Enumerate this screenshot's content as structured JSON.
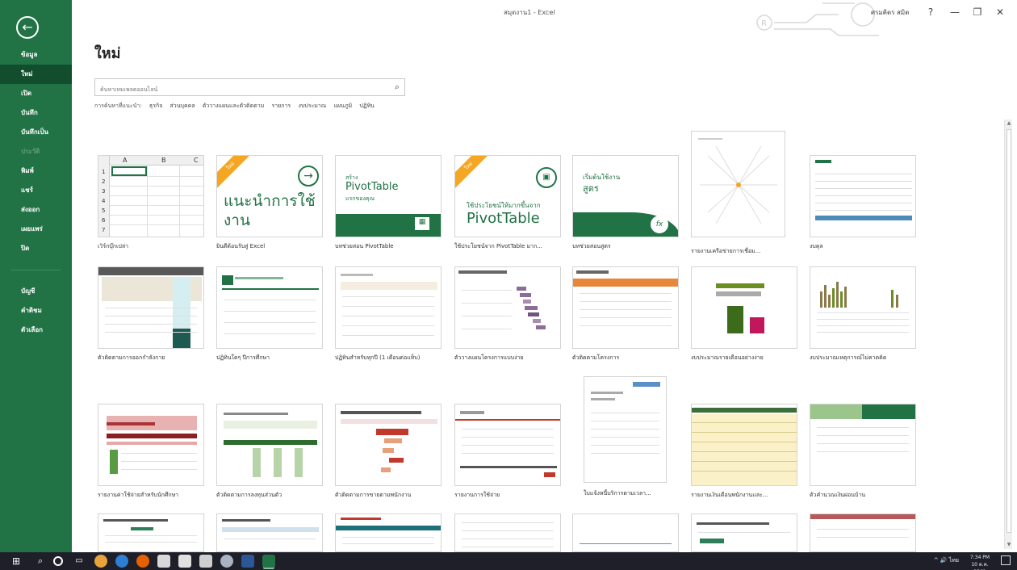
{
  "window": {
    "title": "สมุดงาน1 - Excel",
    "user": "ศรมคิตร สมิต",
    "help": "?",
    "minimize": "—",
    "restore": "❐",
    "close": "✕"
  },
  "sidebar": {
    "back_icon": "arrow-left-icon",
    "items": [
      {
        "label": "ข้อมูล",
        "state": "normal"
      },
      {
        "label": "ใหม่",
        "state": "active"
      },
      {
        "label": "เปิด",
        "state": "normal"
      },
      {
        "label": "บันทึก",
        "state": "normal"
      },
      {
        "label": "บันทึกเป็น",
        "state": "normal"
      },
      {
        "label": "ประวัติ",
        "state": "disabled"
      },
      {
        "label": "พิมพ์",
        "state": "normal"
      },
      {
        "label": "แชร์",
        "state": "normal"
      },
      {
        "label": "ส่งออก",
        "state": "normal"
      },
      {
        "label": "เผยแพร่",
        "state": "normal"
      },
      {
        "label": "ปิด",
        "state": "normal"
      }
    ],
    "bottom_items": [
      {
        "label": "บัญชี"
      },
      {
        "label": "คำติชม"
      },
      {
        "label": "ตัวเลือก"
      }
    ]
  },
  "main": {
    "title": "ใหม่",
    "search_placeholder": "ค้นหาเทมเพลตออนไลน์",
    "suggested_label": "การค้นหาที่แนะนำ:",
    "suggested": [
      "ธุรกิจ",
      "ส่วนบุคคล",
      "ตัววางแผนและตัวติดตาม",
      "รายการ",
      "งบประมาณ",
      "แผนภูมิ",
      "ปฏิทิน"
    ],
    "templates": [
      {
        "label": "เวิร์กบุ๊กเปล่า",
        "kind": "blank"
      },
      {
        "label": "ยินดีต้อนรับสู่ Excel",
        "kind": "welcome",
        "text": "แนะนำการใช้งาน",
        "badge": "ใหม่"
      },
      {
        "label": "บทช่วยสอน PivotTable",
        "kind": "pivot",
        "text1": "สร้าง",
        "text2": "PivotTable",
        "text3": "แรกของคุณ"
      },
      {
        "label": "ใช้ประโยชน์จาก PivotTable มาก...",
        "kind": "pivot2",
        "text1": "ใช้ประโยชน์ให้มากขึ้นจาก",
        "text2": "PivotTable",
        "badge": "ใหม่"
      },
      {
        "label": "บทช่วยสอนสูตร",
        "kind": "formula",
        "text1": "เริ่มต้นใช้งาน",
        "text2": "สูตร",
        "icon": "fx"
      },
      {
        "label": "รายงานเครือข่ายการเชื่อม...",
        "kind": "network"
      },
      {
        "label": "งบดุล",
        "kind": "balance"
      },
      {
        "label": "ตัวติดตามการออกกำลังกาย",
        "kind": "tracker"
      },
      {
        "label": "ปฏิทินใดๆ ปีการศึกษา",
        "kind": "calendar"
      },
      {
        "label": "ปฏิทินสำหรับทุกปี (1 เดือนต่อแท็บ)",
        "kind": "calendar2"
      },
      {
        "label": "ตัววางแผนโครงการแบบง่าย",
        "kind": "gantt"
      },
      {
        "label": "ตัวติดตามโครงการ",
        "kind": "table-orange"
      },
      {
        "label": "งบประมาณรายเดือนอย่างง่าย",
        "kind": "bars"
      },
      {
        "label": "งบประมาณเหตุการณ์ไม่คาดคิด",
        "kind": "bars2"
      },
      {
        "label": "รายงานค่าใช้จ่ายสำหรับนักศึกษา",
        "kind": "red-report"
      },
      {
        "label": "ตัวติดตามการลงทุนส่วนตัว",
        "kind": "green-table"
      },
      {
        "label": "ตัวติดตามการขายตามพนักงาน",
        "kind": "schedule"
      },
      {
        "label": "รายงานการใช้จ่าย",
        "kind": "expense"
      },
      {
        "label": "ใบแจ้งหนี้บริการตามเวลา...",
        "kind": "invoice"
      },
      {
        "label": "รายงานเงินเดือนพนักงานและ...",
        "kind": "yellow-table"
      },
      {
        "label": "ตัวคำนวณเงินผ่อนบ้าน",
        "kind": "loan"
      },
      {
        "label": "",
        "kind": "row4-a"
      },
      {
        "label": "",
        "kind": "row4-b"
      },
      {
        "label": "",
        "kind": "row4-c"
      },
      {
        "label": "",
        "kind": "row4-d"
      },
      {
        "label": "",
        "kind": "row4-e"
      },
      {
        "label": "",
        "kind": "row4-f"
      },
      {
        "label": "",
        "kind": "row4-g"
      }
    ]
  },
  "taskbar": {
    "tray_text": "^ 🔊 ไทย",
    "time": "7:34 PM",
    "date": "10 ต.ค. 2562"
  },
  "colors": {
    "accent": "#217346",
    "accent_dark": "#124e2e",
    "badge": "#f5a623"
  }
}
